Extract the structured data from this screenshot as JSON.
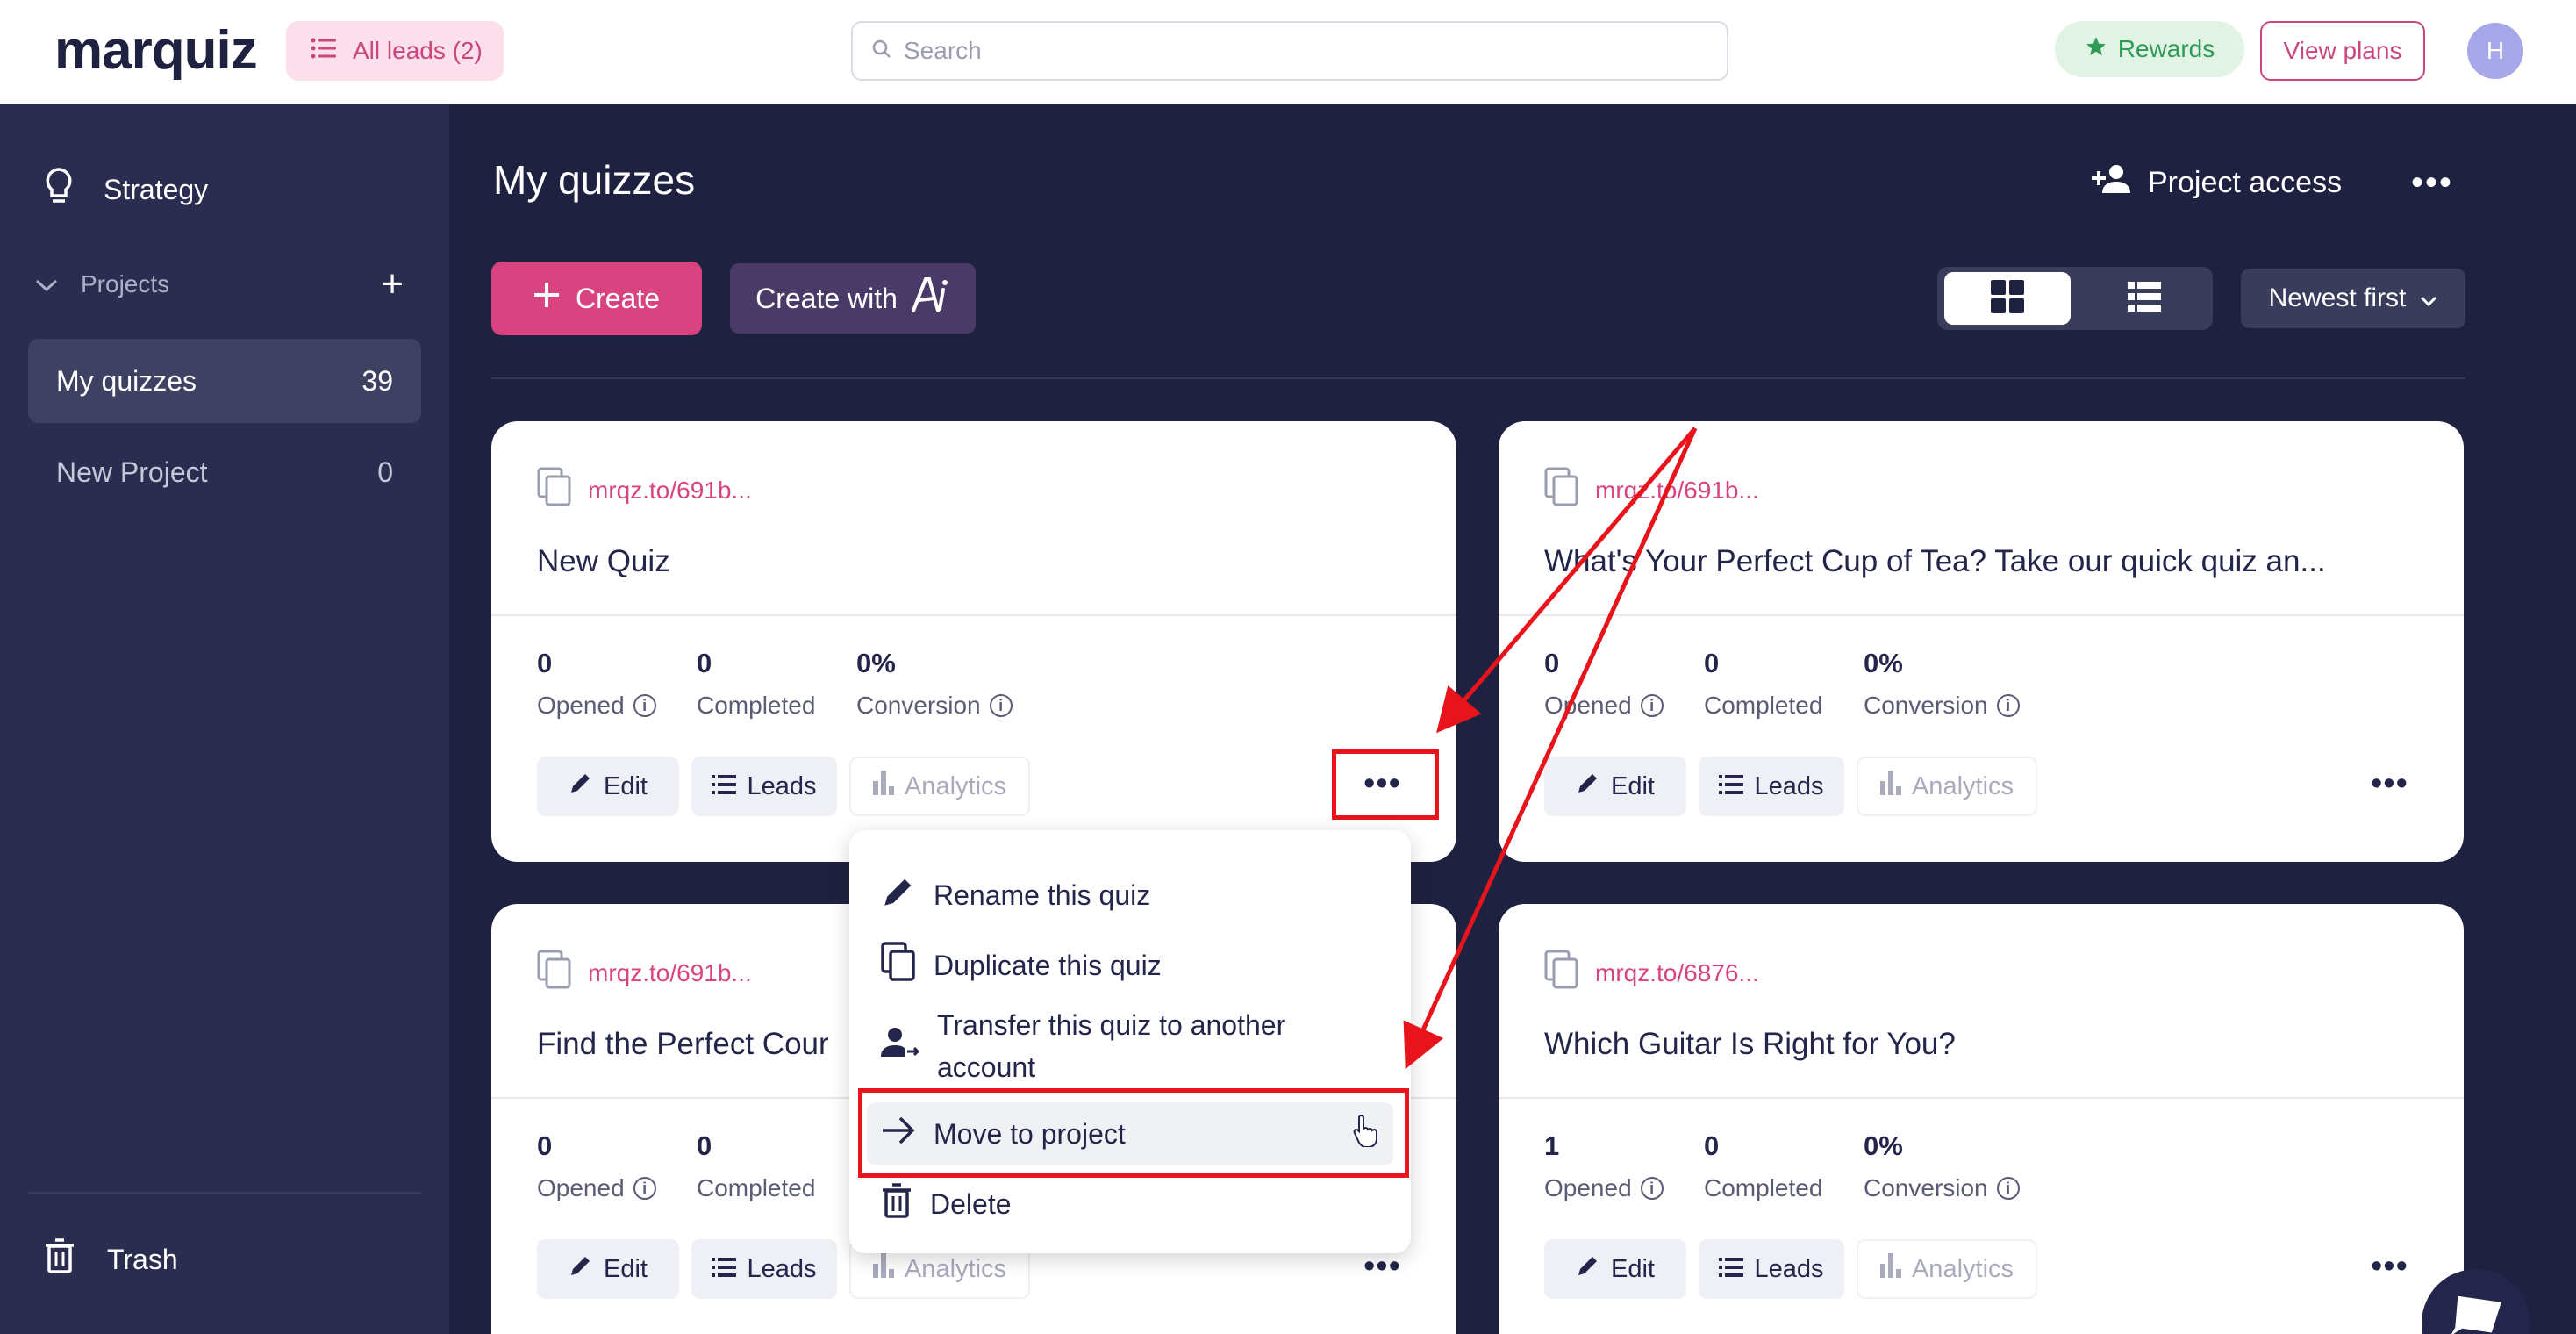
{
  "header": {
    "logo": "marquiz",
    "all_leads": "All leads (2)",
    "search_placeholder": "Search",
    "rewards": "Rewards",
    "view_plans": "View plans",
    "avatar_initial": "H"
  },
  "sidebar": {
    "strategy": "Strategy",
    "projects_label": "Projects",
    "items": [
      {
        "label": "My quizzes",
        "count": "39"
      },
      {
        "label": "New Project",
        "count": "0"
      }
    ],
    "trash": "Trash"
  },
  "main": {
    "title": "My quizzes",
    "project_access": "Project access",
    "create": "Create",
    "create_with": "Create with",
    "sort": "Newest first"
  },
  "stat_labels": {
    "opened": "Opened",
    "completed": "Completed",
    "conversion": "Conversion"
  },
  "button_labels": {
    "edit": "Edit",
    "leads": "Leads",
    "analytics": "Analytics"
  },
  "cards": [
    {
      "link": "mrqz.to/691b...",
      "title": "New Quiz",
      "opened": "0",
      "completed": "0",
      "conversion": "0%"
    },
    {
      "link": "mrqz.to/691b...",
      "title": "What's Your Perfect Cup of Tea? Take our quick quiz an...",
      "opened": "0",
      "completed": "0",
      "conversion": "0%"
    },
    {
      "link": "mrqz.to/691b...",
      "title": "Find the Perfect Cour",
      "opened": "0",
      "completed": "0",
      "conversion": ""
    },
    {
      "link": "mrqz.to/6876...",
      "title": "Which Guitar Is Right for You?",
      "opened": "1",
      "completed": "0",
      "conversion": "0%"
    }
  ],
  "context_menu": {
    "rename": "Rename this quiz",
    "duplicate": "Duplicate this quiz",
    "transfer_line1": "Transfer this quiz to another",
    "transfer_line2": "account",
    "move": "Move to project",
    "delete": "Delete"
  },
  "colors": {
    "brand": "#d9437f",
    "sidebar_bg": "#2b2d50",
    "main_bg": "#1f2140",
    "annotation_red": "#e8141b"
  }
}
